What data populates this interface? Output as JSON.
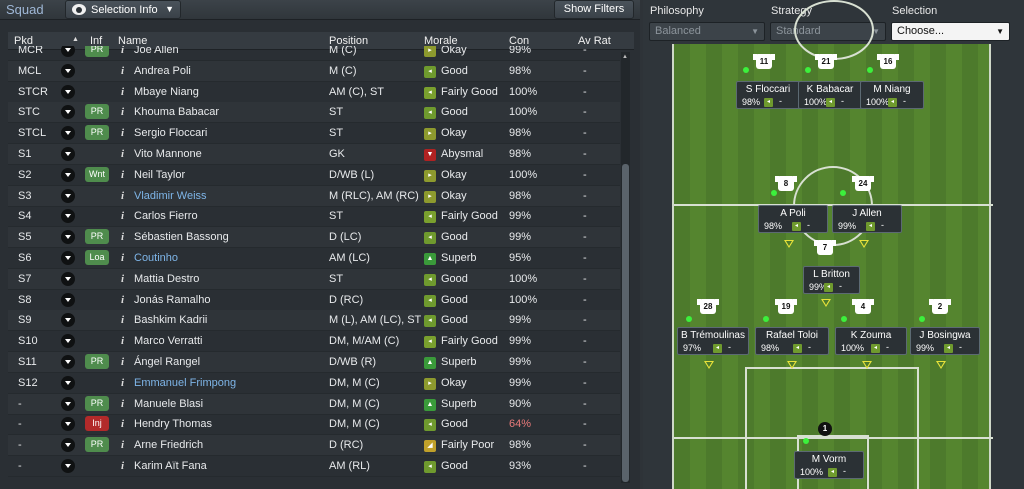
{
  "header": {
    "squad_tab": "Squad",
    "selection_info": "Selection Info",
    "show_filters": "Show Filters"
  },
  "columns": {
    "pkd": "Pkd",
    "inf": "Inf",
    "name": "Name",
    "position": "Position",
    "morale": "Morale",
    "con": "Con",
    "av_rat": "Av Rat"
  },
  "rows": [
    {
      "pkd": "MCR",
      "badge": "PR",
      "name": "Joe Allen",
      "pos": "M (C)",
      "morale": "Okay",
      "con": "99%",
      "avr": "-"
    },
    {
      "pkd": "MCL",
      "badge": "",
      "name": "Andrea Poli",
      "pos": "M (C)",
      "morale": "Good",
      "con": "98%",
      "avr": "-"
    },
    {
      "pkd": "STCR",
      "badge": "",
      "name": "Mbaye Niang",
      "pos": "AM (C), ST",
      "morale": "Fairly Good",
      "con": "100%",
      "avr": "-"
    },
    {
      "pkd": "STC",
      "badge": "PR",
      "name": "Khouma Babacar",
      "pos": "ST",
      "morale": "Good",
      "con": "100%",
      "avr": "-"
    },
    {
      "pkd": "STCL",
      "badge": "PR",
      "name": "Sergio Floccari",
      "pos": "ST",
      "morale": "Okay",
      "con": "98%",
      "avr": "-"
    },
    {
      "pkd": "S1",
      "badge": "",
      "name": "Vito Mannone",
      "pos": "GK",
      "morale": "Abysmal",
      "con": "98%",
      "avr": "-"
    },
    {
      "pkd": "S2",
      "badge": "Wnt",
      "name": "Neil Taylor",
      "pos": "D/WB (L)",
      "morale": "Okay",
      "con": "100%",
      "avr": "-"
    },
    {
      "pkd": "S3",
      "badge": "",
      "name": "Vladimir Weiss",
      "pos": "M (RLC), AM (RC)",
      "morale": "Okay",
      "con": "98%",
      "avr": "-"
    },
    {
      "pkd": "S4",
      "badge": "",
      "name": "Carlos Fierro",
      "pos": "ST",
      "morale": "Fairly Good",
      "con": "99%",
      "avr": "-"
    },
    {
      "pkd": "S5",
      "badge": "PR",
      "name": "Sébastien Bassong",
      "pos": "D (LC)",
      "morale": "Good",
      "con": "99%",
      "avr": "-"
    },
    {
      "pkd": "S6",
      "badge": "Loa",
      "name": "Coutinho",
      "pos": "AM (LC)",
      "morale": "Superb",
      "con": "95%",
      "avr": "-"
    },
    {
      "pkd": "S7",
      "badge": "",
      "name": "Mattia Destro",
      "pos": "ST",
      "morale": "Good",
      "con": "100%",
      "avr": "-"
    },
    {
      "pkd": "S8",
      "badge": "",
      "name": "Jonás Ramalho",
      "pos": "D (RC)",
      "morale": "Good",
      "con": "100%",
      "avr": "-"
    },
    {
      "pkd": "S9",
      "badge": "",
      "name": "Bashkim Kadrii",
      "pos": "M (L), AM (LC), ST",
      "morale": "Good",
      "con": "99%",
      "avr": "-"
    },
    {
      "pkd": "S10",
      "badge": "",
      "name": "Marco Verratti",
      "pos": "DM, M/AM (C)",
      "morale": "Fairly Good",
      "con": "99%",
      "avr": "-"
    },
    {
      "pkd": "S11",
      "badge": "PR",
      "name": "Ángel Rangel",
      "pos": "D/WB (R)",
      "morale": "Superb",
      "con": "99%",
      "avr": "-"
    },
    {
      "pkd": "S12",
      "badge": "",
      "name": "Emmanuel Frimpong",
      "pos": "DM, M (C)",
      "morale": "Okay",
      "con": "99%",
      "avr": "-"
    },
    {
      "pkd": "-",
      "badge": "PR",
      "name": "Manuele Blasi",
      "pos": "DM, M (C)",
      "morale": "Superb",
      "con": "90%",
      "avr": "-"
    },
    {
      "pkd": "-",
      "badge": "Inj",
      "name": "Hendry Thomas",
      "pos": "DM, M (C)",
      "morale": "Good",
      "con": "64%",
      "avr": "-"
    },
    {
      "pkd": "-",
      "badge": "PR",
      "name": "Arne Friedrich",
      "pos": "D (RC)",
      "morale": "Fairly Poor",
      "con": "98%",
      "avr": "-"
    },
    {
      "pkd": "-",
      "badge": "",
      "name": "Karim Aït Fana",
      "pos": "AM (RL)",
      "morale": "Good",
      "con": "93%",
      "avr": "-"
    }
  ],
  "tactics": {
    "philosophy_label": "Philosophy",
    "philosophy_value": "Balanced",
    "strategy_label": "Strategy",
    "strategy_value": "Standard",
    "selection_label": "Selection",
    "selection_value": "Choose..."
  },
  "pitch_players": [
    {
      "num": "11",
      "name": "S Floccari",
      "con": "98%"
    },
    {
      "num": "21",
      "name": "K Babacar",
      "con": "100%"
    },
    {
      "num": "16",
      "name": "M Niang",
      "con": "100%"
    },
    {
      "num": "8",
      "name": "A Poli",
      "con": "98%"
    },
    {
      "num": "24",
      "name": "J Allen",
      "con": "99%"
    },
    {
      "num": "7",
      "name": "L Britton",
      "con": "99%"
    },
    {
      "num": "28",
      "name": "B Trémoulinas",
      "con": "97%"
    },
    {
      "num": "19",
      "name": "Rafael Toloi",
      "con": "98%"
    },
    {
      "num": "4",
      "name": "K Zouma",
      "con": "100%"
    },
    {
      "num": "2",
      "name": "J Bosingwa",
      "con": "99%"
    },
    {
      "num": "1",
      "name": "M Vorm",
      "con": "100%"
    }
  ],
  "dash": "-",
  "colors": {
    "accent_link": "#7eb5e8",
    "pitch": "#4d7a2c",
    "tag_border": "#5c6a73"
  }
}
